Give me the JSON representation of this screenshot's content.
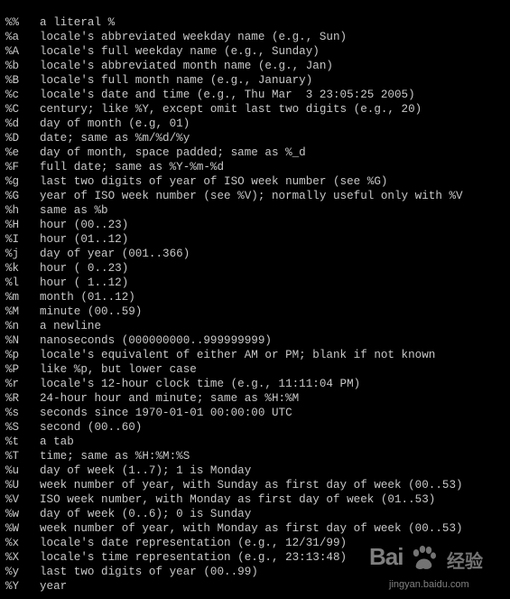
{
  "terminal": {
    "lines": [
      {
        "code": "%%",
        "desc": "a literal %"
      },
      {
        "code": "%a",
        "desc": "locale's abbreviated weekday name (e.g., Sun)"
      },
      {
        "code": "%A",
        "desc": "locale's full weekday name (e.g., Sunday)"
      },
      {
        "code": "%b",
        "desc": "locale's abbreviated month name (e.g., Jan)"
      },
      {
        "code": "%B",
        "desc": "locale's full month name (e.g., January)"
      },
      {
        "code": "%c",
        "desc": "locale's date and time (e.g., Thu Mar  3 23:05:25 2005)"
      },
      {
        "code": "%C",
        "desc": "century; like %Y, except omit last two digits (e.g., 20)"
      },
      {
        "code": "%d",
        "desc": "day of month (e.g, 01)"
      },
      {
        "code": "%D",
        "desc": "date; same as %m/%d/%y"
      },
      {
        "code": "%e",
        "desc": "day of month, space padded; same as %_d"
      },
      {
        "code": "%F",
        "desc": "full date; same as %Y-%m-%d"
      },
      {
        "code": "%g",
        "desc": "last two digits of year of ISO week number (see %G)"
      },
      {
        "code": "%G",
        "desc": "year of ISO week number (see %V); normally useful only with %V"
      },
      {
        "code": "%h",
        "desc": "same as %b"
      },
      {
        "code": "%H",
        "desc": "hour (00..23)"
      },
      {
        "code": "%I",
        "desc": "hour (01..12)"
      },
      {
        "code": "%j",
        "desc": "day of year (001..366)"
      },
      {
        "code": "%k",
        "desc": "hour ( 0..23)"
      },
      {
        "code": "%l",
        "desc": "hour ( 1..12)"
      },
      {
        "code": "%m",
        "desc": "month (01..12)"
      },
      {
        "code": "%M",
        "desc": "minute (00..59)"
      },
      {
        "code": "%n",
        "desc": "a newline"
      },
      {
        "code": "%N",
        "desc": "nanoseconds (000000000..999999999)"
      },
      {
        "code": "%p",
        "desc": "locale's equivalent of either AM or PM; blank if not known"
      },
      {
        "code": "%P",
        "desc": "like %p, but lower case"
      },
      {
        "code": "%r",
        "desc": "locale's 12-hour clock time (e.g., 11:11:04 PM)"
      },
      {
        "code": "%R",
        "desc": "24-hour hour and minute; same as %H:%M"
      },
      {
        "code": "%s",
        "desc": "seconds since 1970-01-01 00:00:00 UTC"
      },
      {
        "code": "%S",
        "desc": "second (00..60)"
      },
      {
        "code": "%t",
        "desc": "a tab"
      },
      {
        "code": "%T",
        "desc": "time; same as %H:%M:%S"
      },
      {
        "code": "%u",
        "desc": "day of week (1..7); 1 is Monday"
      },
      {
        "code": "%U",
        "desc": "week number of year, with Sunday as first day of week (00..53)"
      },
      {
        "code": "%V",
        "desc": "ISO week number, with Monday as first day of week (01..53)"
      },
      {
        "code": "%w",
        "desc": "day of week (0..6); 0 is Sunday"
      },
      {
        "code": "%W",
        "desc": "week number of year, with Monday as first day of week (00..53)"
      },
      {
        "code": "%x",
        "desc": "locale's date representation (e.g., 12/31/99)"
      },
      {
        "code": "%X",
        "desc": "locale's time representation (e.g., 23:13:48)"
      },
      {
        "code": "%y",
        "desc": "last two digits of year (00..99)"
      },
      {
        "code": "%Y",
        "desc": "year"
      }
    ]
  },
  "watermark": {
    "logo_left": "Bai",
    "logo_right": "经验",
    "url": "jingyan.baidu.com"
  },
  "colors": {
    "background": "#000000",
    "text": "#c8c8c8"
  }
}
